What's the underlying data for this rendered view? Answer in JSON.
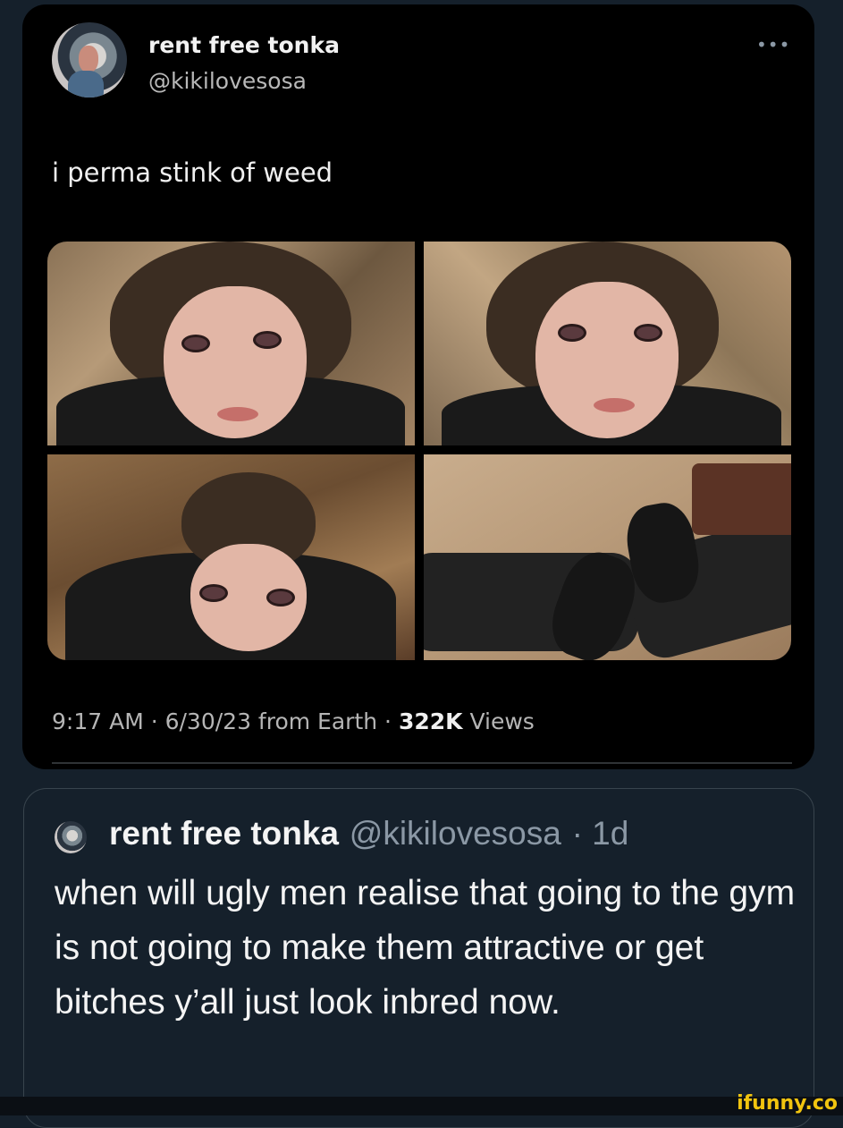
{
  "tweet": {
    "display_name": "rent free tonka",
    "handle": "@kikilovesosa",
    "more_icon": "more-horizontal-icon",
    "text": "i perma stink of weed",
    "meta": {
      "time_date_source": "9:17 AM · 6/30/23 from Earth · ",
      "views_count": "322K",
      "views_label": " Views"
    }
  },
  "quote": {
    "name": "rent free tonka",
    "handle": "@kikilovesosa",
    "time": "· 1d",
    "text": "when will ugly men realise that going to the gym is not going to make them attractive or get bitches y’all just look inbred now."
  },
  "watermark": "ifunny.co",
  "colors": {
    "background": "#15202b",
    "card": "#000000",
    "watermark": "#f1c40f"
  }
}
